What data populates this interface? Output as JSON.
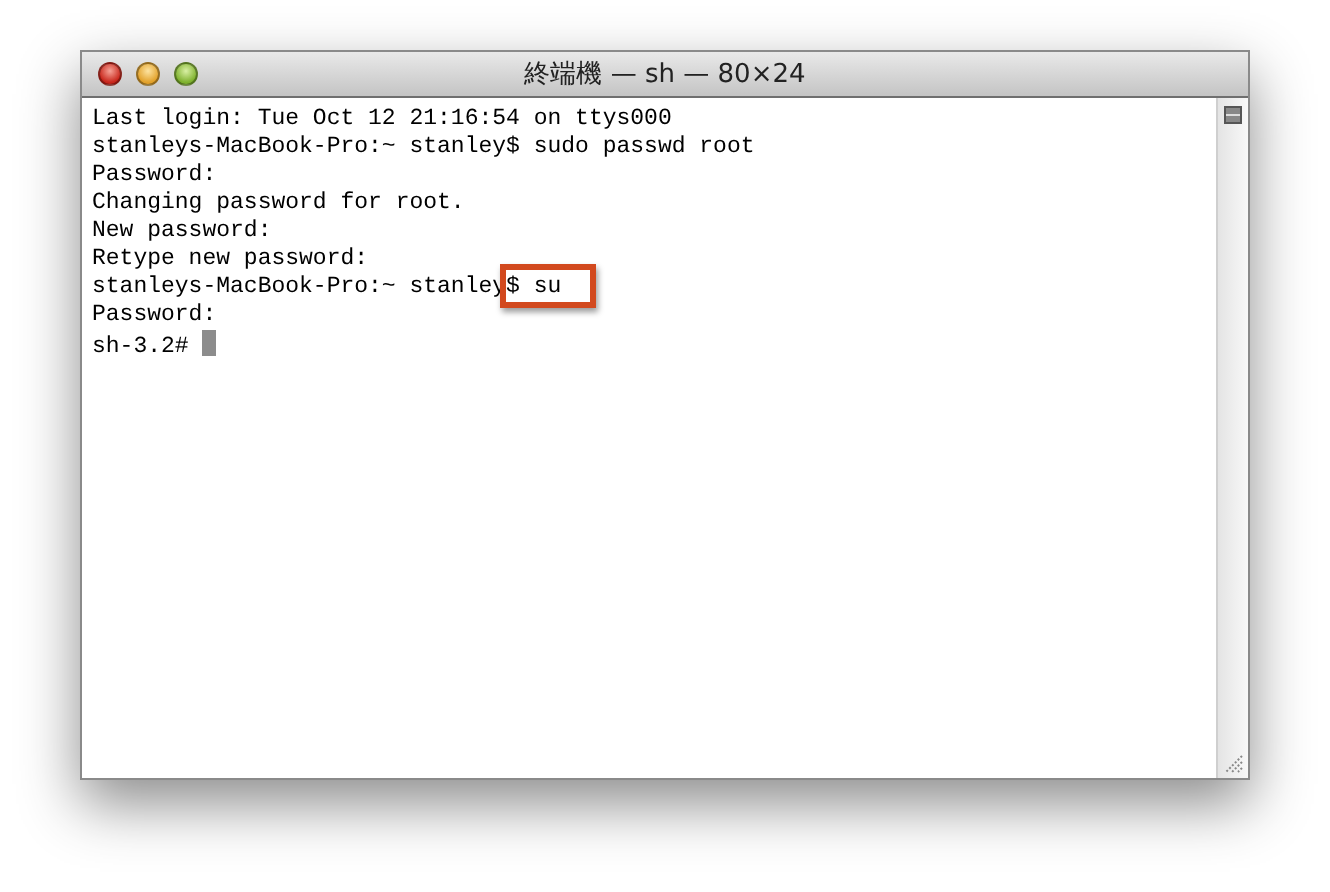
{
  "window": {
    "title": "終端機 — sh — 80×24"
  },
  "lines": [
    {
      "text": "Last login: Tue Oct 12 21:16:54 on ttys000",
      "highlight": false,
      "cursor": false
    },
    {
      "text": "stanleys-MacBook-Pro:~ stanley$ sudo passwd root",
      "highlight": false,
      "cursor": false
    },
    {
      "text": "Password:",
      "highlight": false,
      "cursor": false
    },
    {
      "text": "Changing password for root.",
      "highlight": false,
      "cursor": false
    },
    {
      "text": "New password:",
      "highlight": false,
      "cursor": false
    },
    {
      "text": "Retype new password:",
      "highlight": false,
      "cursor": false
    },
    {
      "text": "stanleys-MacBook-Pro:~ stanley$ su",
      "highlight": true,
      "cursor": false
    },
    {
      "text": "Password:",
      "highlight": false,
      "cursor": false
    },
    {
      "text": "sh-3.2#",
      "highlight": false,
      "cursor": true
    }
  ]
}
